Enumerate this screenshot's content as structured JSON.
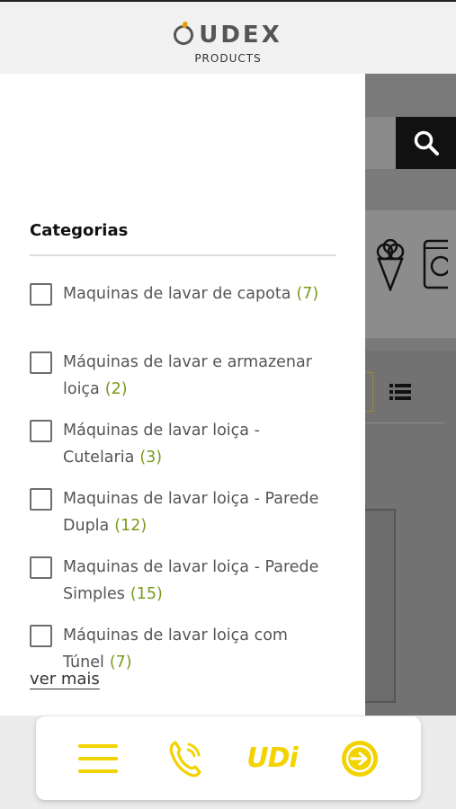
{
  "header": {
    "logo_text": "UDEX",
    "logo_sub": "PRODUCTS"
  },
  "drawer": {
    "title": "Categorias",
    "items": [
      {
        "label": "Maquinas de lavar de capota",
        "count": "(7)"
      },
      {
        "label": "Máquinas de lavar e armazenar loiça",
        "count": "(2)"
      },
      {
        "label": "Máquinas de lavar loiça - Cutelaria",
        "count": "(3)"
      },
      {
        "label": "Maquinas de lavar loiça - Parede Dupla",
        "count": "(12)"
      },
      {
        "label": "Maquinas de lavar loiça - Parede Simples",
        "count": "(15)"
      },
      {
        "label": "Máquinas de lavar loiça com Túnel",
        "count": "(7)"
      }
    ],
    "more_label": "ver mais"
  },
  "bottom_nav": {
    "udi_label": "UDi",
    "icons": [
      "menu-icon",
      "phone-icon",
      "udi-logo",
      "login-icon"
    ]
  },
  "colors": {
    "accent": "#f2d300",
    "count": "#7a9a1a"
  }
}
